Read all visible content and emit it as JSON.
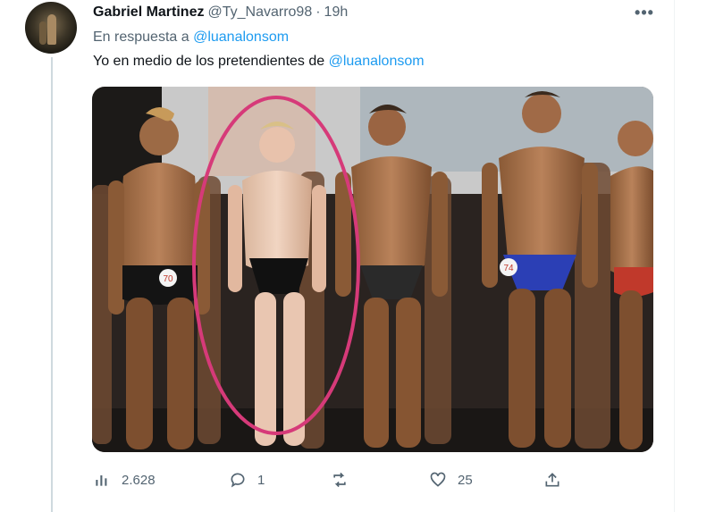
{
  "tweet": {
    "author_name": "Gabriel Martinez",
    "author_handle": "@Ty_Navarro98",
    "separator": "·",
    "time": "19h",
    "more_label": "•••",
    "reply_prefix": "En respuesta a",
    "reply_mention": "@luanalonsom",
    "text": "Yo en medio de los pretendientes de",
    "text_mention": "@luanalonsom",
    "media": {
      "description_icon": "photo",
      "number_tags": [
        "70",
        "74"
      ],
      "highlight_color": "#d63a79"
    }
  },
  "actions": {
    "views": {
      "icon": "bar-chart-icon",
      "count": "2.628"
    },
    "reply": {
      "icon": "reply-icon",
      "count": "1"
    },
    "retweet": {
      "icon": "retweet-icon",
      "count": ""
    },
    "like": {
      "icon": "heart-icon",
      "count": "25"
    },
    "share": {
      "icon": "share-icon",
      "count": ""
    }
  },
  "colors": {
    "text_primary": "#0f1419",
    "text_secondary": "#536471",
    "link": "#1d9bf0",
    "thread_line": "#cfd9de"
  }
}
